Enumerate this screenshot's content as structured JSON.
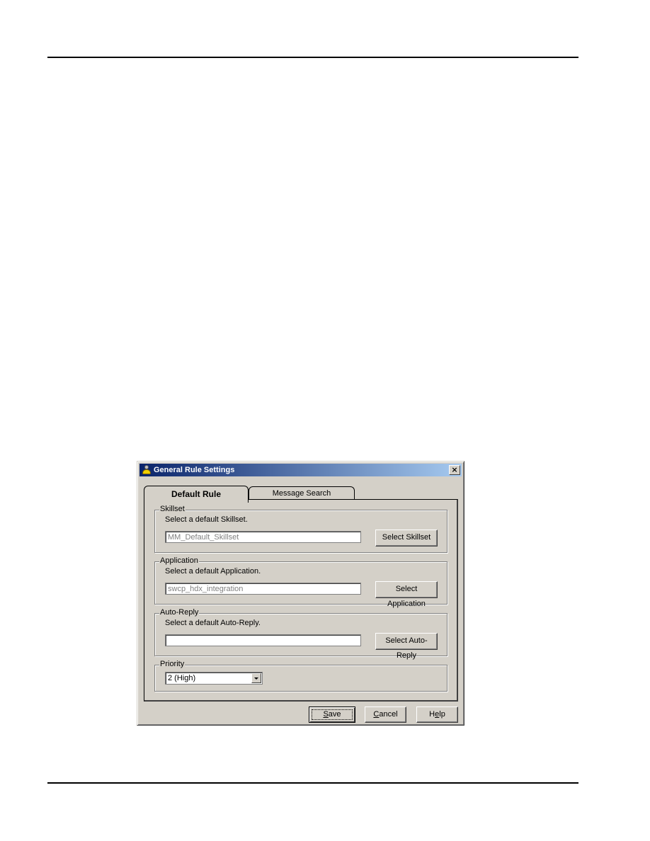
{
  "dialog": {
    "title": "General Rule Settings",
    "title_icon": "agent-person-icon",
    "close_glyph": "×",
    "tabs": [
      {
        "label": "Default Rule",
        "active": true
      },
      {
        "label": "Message Search",
        "active": false
      }
    ],
    "groups": {
      "skillset": {
        "legend": "Skillset",
        "description": "Select a default Skillset.",
        "value": "MM_Default_Skillset",
        "button": "Select Skillset"
      },
      "application": {
        "legend": "Application",
        "description": "Select a default Application.",
        "value": "swcp_hdx_integration",
        "button": "Select Application"
      },
      "auto_reply": {
        "legend": "Auto-Reply",
        "description": "Select a default Auto-Reply.",
        "value": "",
        "button": "Select Auto-Reply"
      },
      "priority": {
        "legend": "Priority",
        "selected": "2 (High)"
      }
    },
    "footer": {
      "save": {
        "pre": "",
        "mnemonic": "S",
        "post": "ave"
      },
      "cancel": {
        "pre": "",
        "mnemonic": "C",
        "post": "ancel"
      },
      "help": {
        "pre": "H",
        "mnemonic": "e",
        "post": "lp"
      }
    }
  }
}
